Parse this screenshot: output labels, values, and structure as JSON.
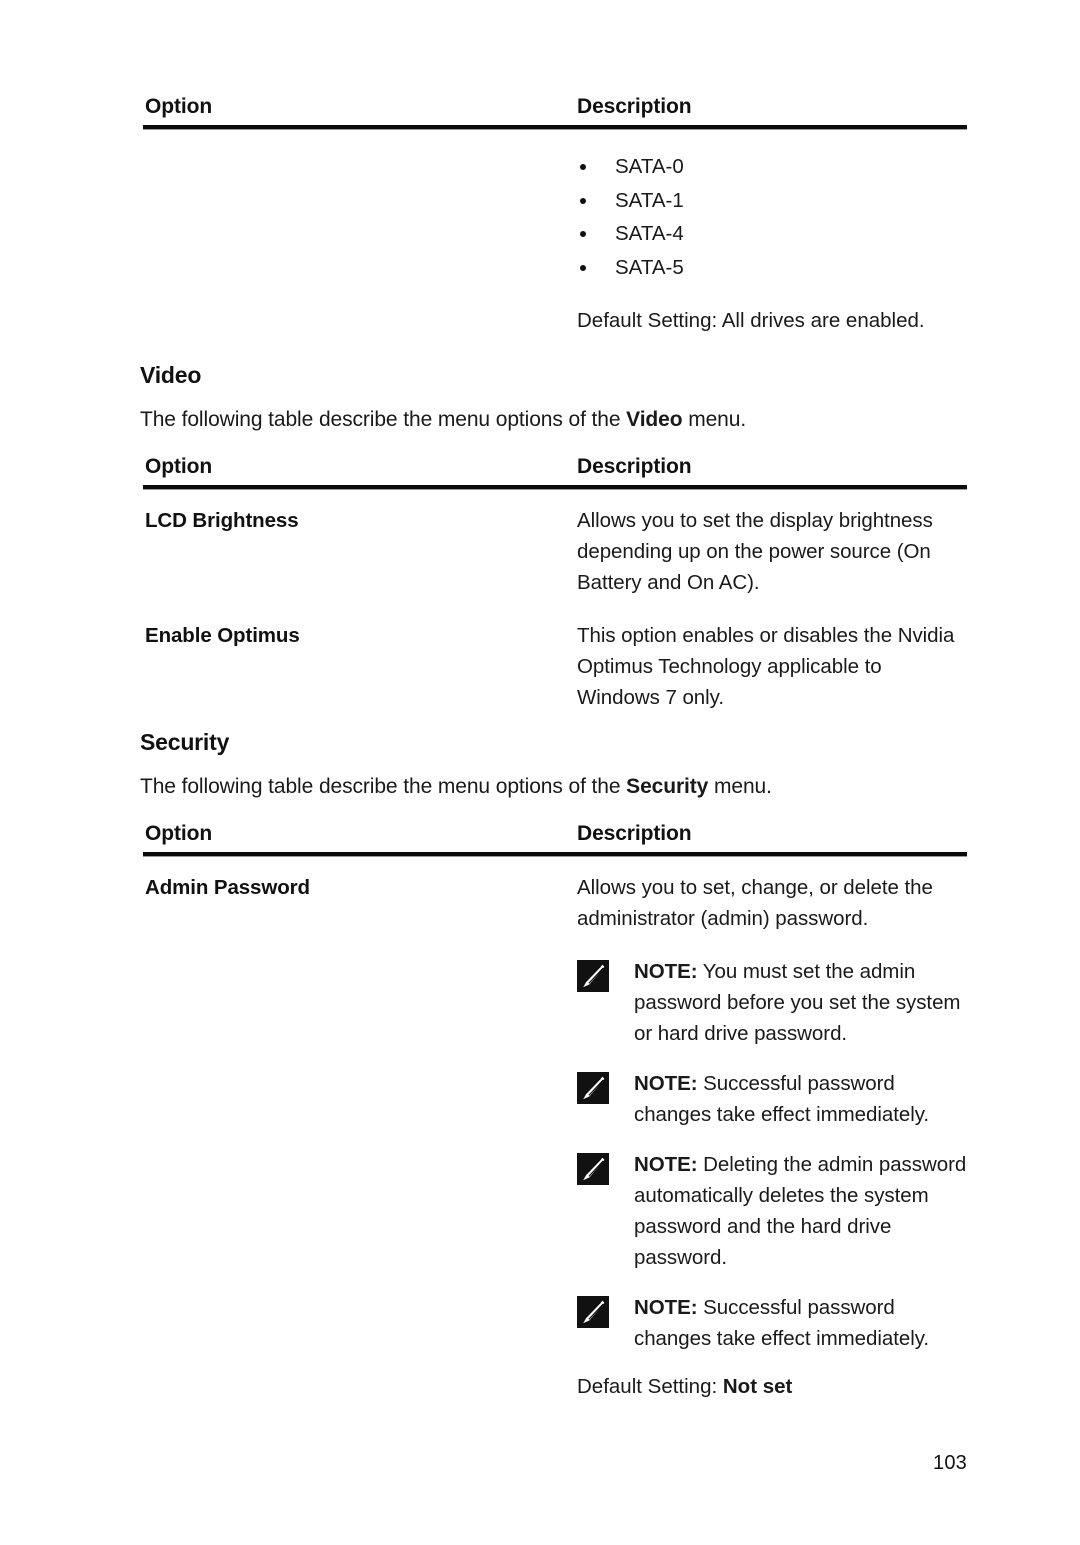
{
  "page": {
    "number": "103"
  },
  "tables": {
    "columns": {
      "option": "Option",
      "description": "Description"
    }
  },
  "continued_table": {
    "bullets": [
      "SATA-0",
      "SATA-1",
      "SATA-4",
      "SATA-5"
    ],
    "default_setting_prefix": "Default Setting:",
    "default_setting_value": " All drives are enabled."
  },
  "video_section": {
    "heading": "Video",
    "intro_before": "The following table describe the menu options of the ",
    "intro_bold": "Video",
    "intro_after": " menu.",
    "rows": [
      {
        "option": "LCD Brightness",
        "description": "Allows you to set the display brightness depending up on the power source (On Battery and On AC)."
      },
      {
        "option": "Enable Optimus",
        "description": "This option enables or disables the Nvidia Optimus Technology applicable to Windows 7 only."
      }
    ]
  },
  "security_section": {
    "heading": "Security",
    "intro_before": "The following table describe the menu options of the ",
    "intro_bold": "Security",
    "intro_after": " menu.",
    "row": {
      "option": "Admin Password",
      "description": "Allows you to set, change, or delete the administrator (admin) password.",
      "notes": [
        {
          "label": "NOTE:",
          "text": " You must set the admin password before you set the system or hard drive password."
        },
        {
          "label": "NOTE:",
          "text": " Successful password changes take effect immediately."
        },
        {
          "label": "NOTE:",
          "text": " Deleting the admin password automatically deletes the system password and the hard drive password."
        },
        {
          "label": "NOTE:",
          "text": " Successful password changes take effect immediately."
        }
      ],
      "default_setting_prefix": "Default Setting:",
      "default_setting_value": "Not set"
    }
  },
  "icons": {
    "note": "note-pencil-icon"
  },
  "colors": {
    "text": "#111111",
    "rule": "#0b0b0b",
    "background": "#ffffff"
  }
}
